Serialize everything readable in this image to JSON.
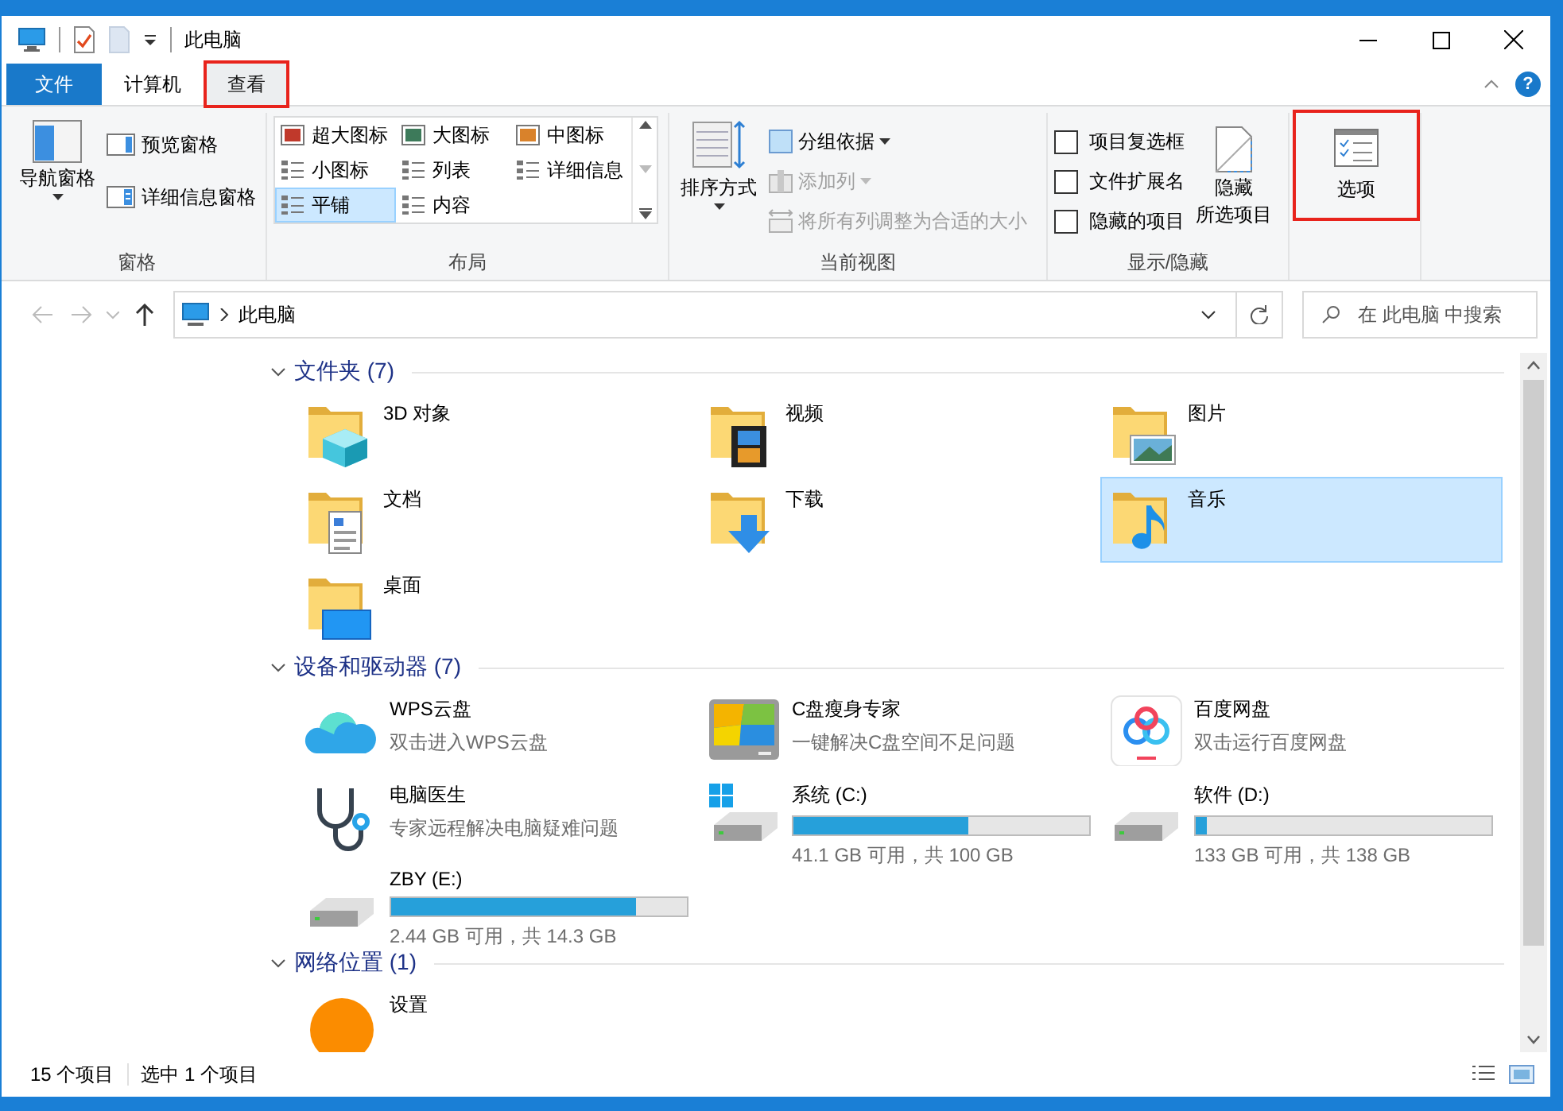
{
  "window": {
    "title": "此电脑",
    "help": "?"
  },
  "ribbon": {
    "tabs": [
      {
        "label": "文件",
        "kind": "file",
        "selected": false,
        "highlighted": false
      },
      {
        "label": "计算机",
        "kind": "tab",
        "selected": false,
        "highlighted": false
      },
      {
        "label": "查看",
        "kind": "tab",
        "selected": true,
        "highlighted": true
      }
    ],
    "panes": {
      "label": "窗格",
      "navigation_pane": "导航窗格",
      "preview_pane": "预览窗格",
      "details_pane": "详细信息窗格"
    },
    "layout": {
      "label": "布局",
      "options": [
        {
          "label": "超大图标",
          "selected": false
        },
        {
          "label": "大图标",
          "selected": false
        },
        {
          "label": "中图标",
          "selected": false
        },
        {
          "label": "小图标",
          "selected": false
        },
        {
          "label": "列表",
          "selected": false
        },
        {
          "label": "详细信息",
          "selected": false
        },
        {
          "label": "平铺",
          "selected": true
        },
        {
          "label": "内容",
          "selected": false
        }
      ]
    },
    "current_view": {
      "label": "当前视图",
      "sort_by": "排序方式",
      "commands": [
        {
          "label": "分组依据",
          "disabled": false,
          "dropdown": true
        },
        {
          "label": "添加列",
          "disabled": true,
          "dropdown": true
        },
        {
          "label": "将所有列调整为合适的大小",
          "disabled": true,
          "dropdown": false
        }
      ]
    },
    "show_hide": {
      "label": "显示/隐藏",
      "checkboxes": [
        {
          "label": "项目复选框",
          "checked": false
        },
        {
          "label": "文件扩展名",
          "checked": false
        },
        {
          "label": "隐藏的项目",
          "checked": false
        }
      ],
      "hide_selected": [
        "隐藏",
        "所选项目"
      ]
    },
    "options": {
      "label": "选项",
      "highlighted": true
    }
  },
  "address_bar": {
    "path": "此电脑"
  },
  "search": {
    "placeholder": "在 此电脑 中搜索"
  },
  "groups": [
    {
      "title": "文件夹 (7)",
      "expanded": true,
      "items": [
        {
          "name": "3D 对象",
          "kind": "objects3d",
          "selected": false
        },
        {
          "name": "视频",
          "kind": "videos",
          "selected": false
        },
        {
          "name": "图片",
          "kind": "pictures",
          "selected": false
        },
        {
          "name": "文档",
          "kind": "documents",
          "selected": false
        },
        {
          "name": "下载",
          "kind": "downloads",
          "selected": false
        },
        {
          "name": "音乐",
          "kind": "music",
          "selected": true
        },
        {
          "name": "桌面",
          "kind": "desktop",
          "selected": false
        }
      ]
    },
    {
      "title": "设备和驱动器 (7)",
      "expanded": true,
      "items": [
        {
          "name": "WPS云盘",
          "kind": "cloud",
          "subtitle": "双击进入WPS云盘",
          "selected": false
        },
        {
          "name": "C盘瘦身专家",
          "kind": "cleaner",
          "subtitle": "一键解决C盘空间不足问题",
          "selected": false
        },
        {
          "name": "百度网盘",
          "kind": "rings",
          "subtitle": "双击运行百度网盘",
          "selected": false
        },
        {
          "name": "电脑医生",
          "kind": "doctor",
          "subtitle": "专家远程解决电脑疑难问题",
          "selected": false
        },
        {
          "name": "系统 (C:)",
          "kind": "sysdrive",
          "level": 0.59,
          "free": "41.1 GB 可用，共 100 GB",
          "selected": false
        },
        {
          "name": "软件 (D:)",
          "kind": "drive",
          "level": 0.04,
          "free": "133 GB 可用，共 138 GB",
          "selected": false
        },
        {
          "name": "ZBY (E:)",
          "kind": "drive",
          "level": 0.83,
          "free": "2.44 GB 可用，共 14.3 GB",
          "selected": false
        }
      ]
    },
    {
      "title": "网络位置 (1)",
      "expanded": true,
      "items": [
        {
          "name": "设置",
          "kind": "network",
          "selected": false
        }
      ]
    }
  ],
  "status_bar": {
    "item_count": "15 个项目",
    "selection": "选中 1 个项目"
  }
}
